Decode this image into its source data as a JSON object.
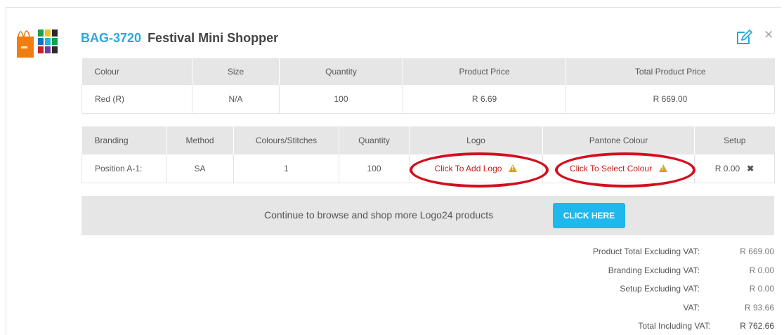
{
  "product": {
    "code": "BAG-3720",
    "name": "Festival Mini Shopper"
  },
  "product_table": {
    "headers": [
      "Colour",
      "Size",
      "Quantity",
      "Product Price",
      "Total Product Price"
    ],
    "row": [
      "Red (R)",
      "N/A",
      "100",
      "R 6.69",
      "R 669.00"
    ]
  },
  "branding_table": {
    "headers": [
      "Branding",
      "Method",
      "Colours/Stitches",
      "Quantity",
      "Logo",
      "Pantone Colour",
      "Setup"
    ],
    "row": {
      "branding": "Position A-1:",
      "method": "SA",
      "colours": "1",
      "quantity": "100",
      "logo_link": "Click To Add Logo",
      "pantone_link": "Click To Select Colour",
      "setup": "R 0.00"
    }
  },
  "browse": {
    "text": "Continue to browse and shop more Logo24 products",
    "button": "CLICK HERE"
  },
  "totals": [
    {
      "label": "Product Total Excluding VAT:",
      "value": "R 669.00"
    },
    {
      "label": "Branding Excluding VAT:",
      "value": "R 0.00"
    },
    {
      "label": "Setup Excluding VAT:",
      "value": "R 0.00"
    },
    {
      "label": "VAT:",
      "value": "R 93.66"
    },
    {
      "label": "Total Including VAT:",
      "value": "R 762.66"
    }
  ],
  "colors": {
    "accent": "#29a8dc",
    "button": "#1fb8ec",
    "warning_text": "#c81a1a",
    "highlight_ellipse": "#d40f1e",
    "warning_icon": "#d9a11c"
  },
  "icons": {
    "edit": "edit-icon",
    "close": "close-icon",
    "warning": "warning-icon",
    "remove": "remove-icon"
  }
}
